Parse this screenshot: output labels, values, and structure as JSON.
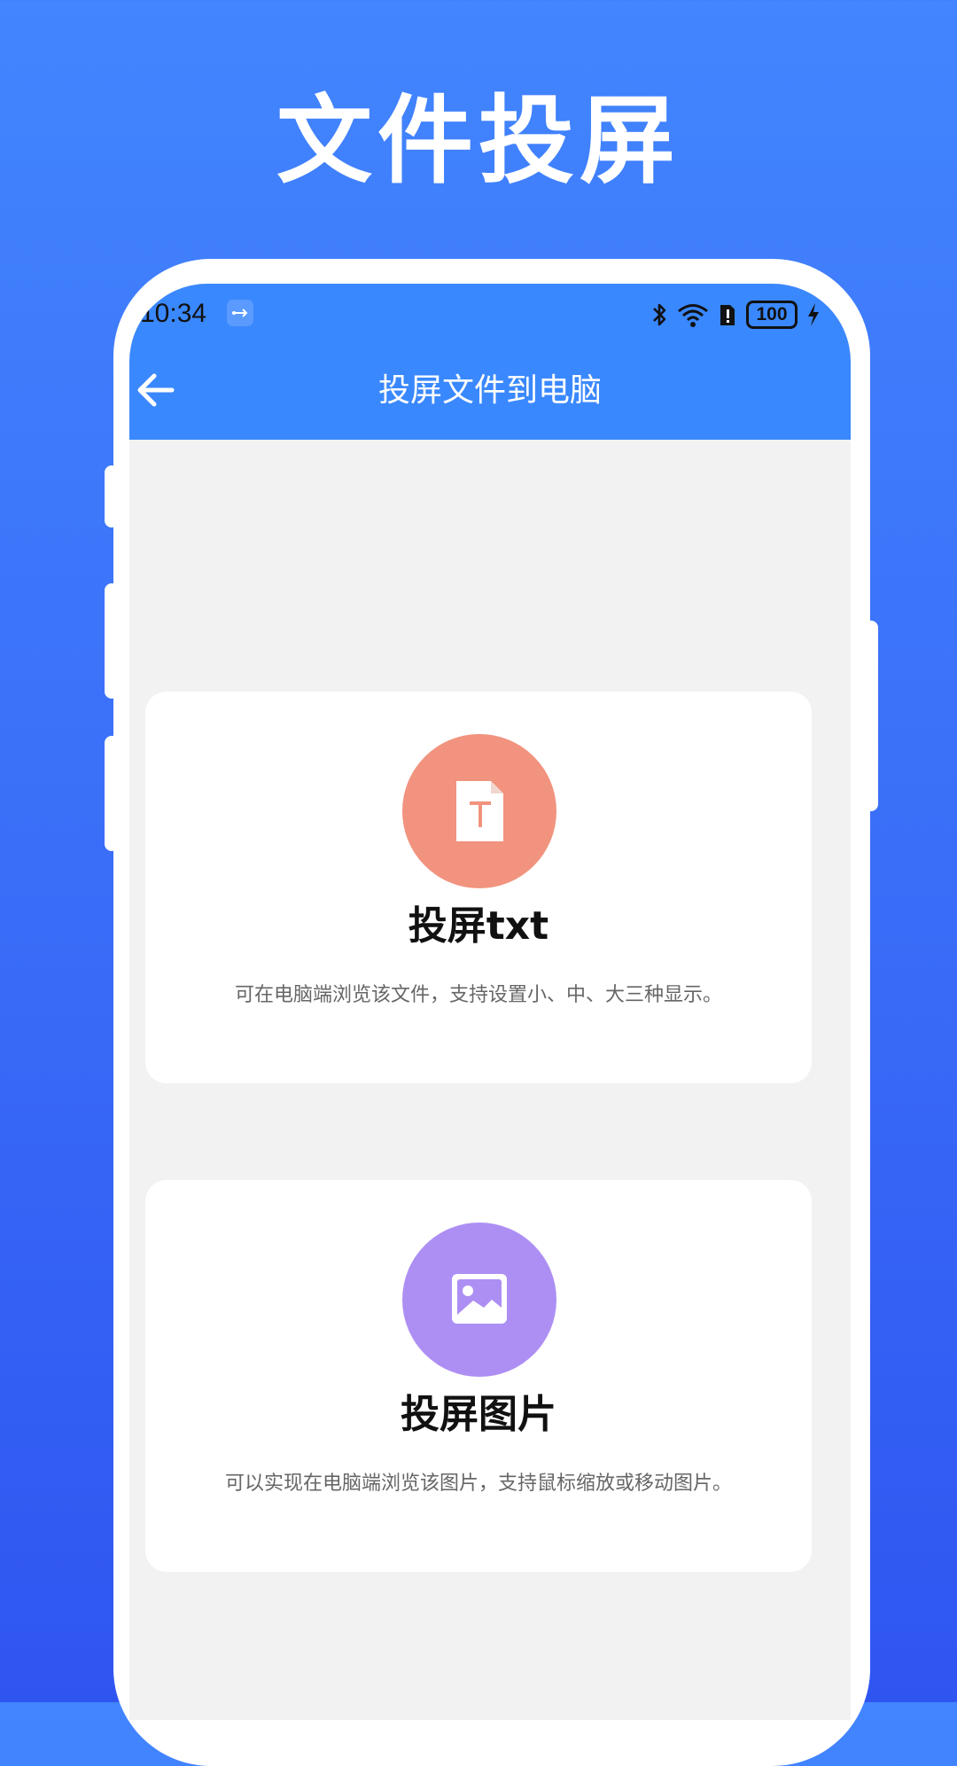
{
  "promo": {
    "title": "文件投屏"
  },
  "status_bar": {
    "time": "10:34",
    "battery": "100"
  },
  "app_bar": {
    "title": "投屏文件到电脑"
  },
  "cards": [
    {
      "title": "投屏txt",
      "description": "可在电脑端浏览该文件，支持设置小、中、大三种显示。",
      "icon": "text-file-icon",
      "color": "#f1937e"
    },
    {
      "title": "投屏图片",
      "description": "可以实现在电脑端浏览该图片，支持鼠标缩放或移动图片。",
      "icon": "image-icon",
      "color": "#ad8ff4"
    }
  ],
  "colors": {
    "app_bar": "#3a88fd",
    "background_top": "#4285fe",
    "background_bottom": "#2f55f1"
  }
}
